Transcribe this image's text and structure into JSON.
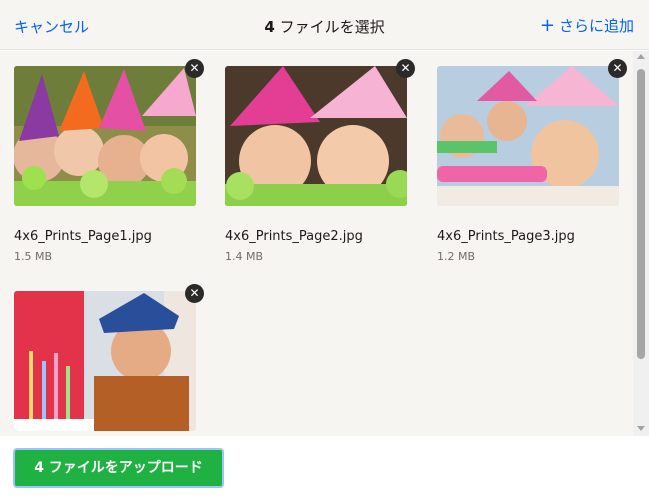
{
  "header": {
    "cancel_label": "キャンセル",
    "title_count": "4",
    "title_text": " ファイルを選択",
    "add_more_label": "さらに追加"
  },
  "files": [
    {
      "name": "4x6_Prints_Page1.jpg",
      "size": "1.5 MB"
    },
    {
      "name": "4x6_Prints_Page2.jpg",
      "size": "1.4 MB"
    },
    {
      "name": "4x6_Prints_Page3.jpg",
      "size": "1.2 MB"
    },
    {
      "name": "",
      "size": ""
    }
  ],
  "icons": {
    "remove": "close-icon",
    "add": "plus-icon"
  },
  "footer": {
    "upload_label": "4 ファイルをアップロード"
  },
  "colors": {
    "accent": "#0061fe",
    "upload_button": "#1fb141",
    "background": "#f7f5f2"
  }
}
